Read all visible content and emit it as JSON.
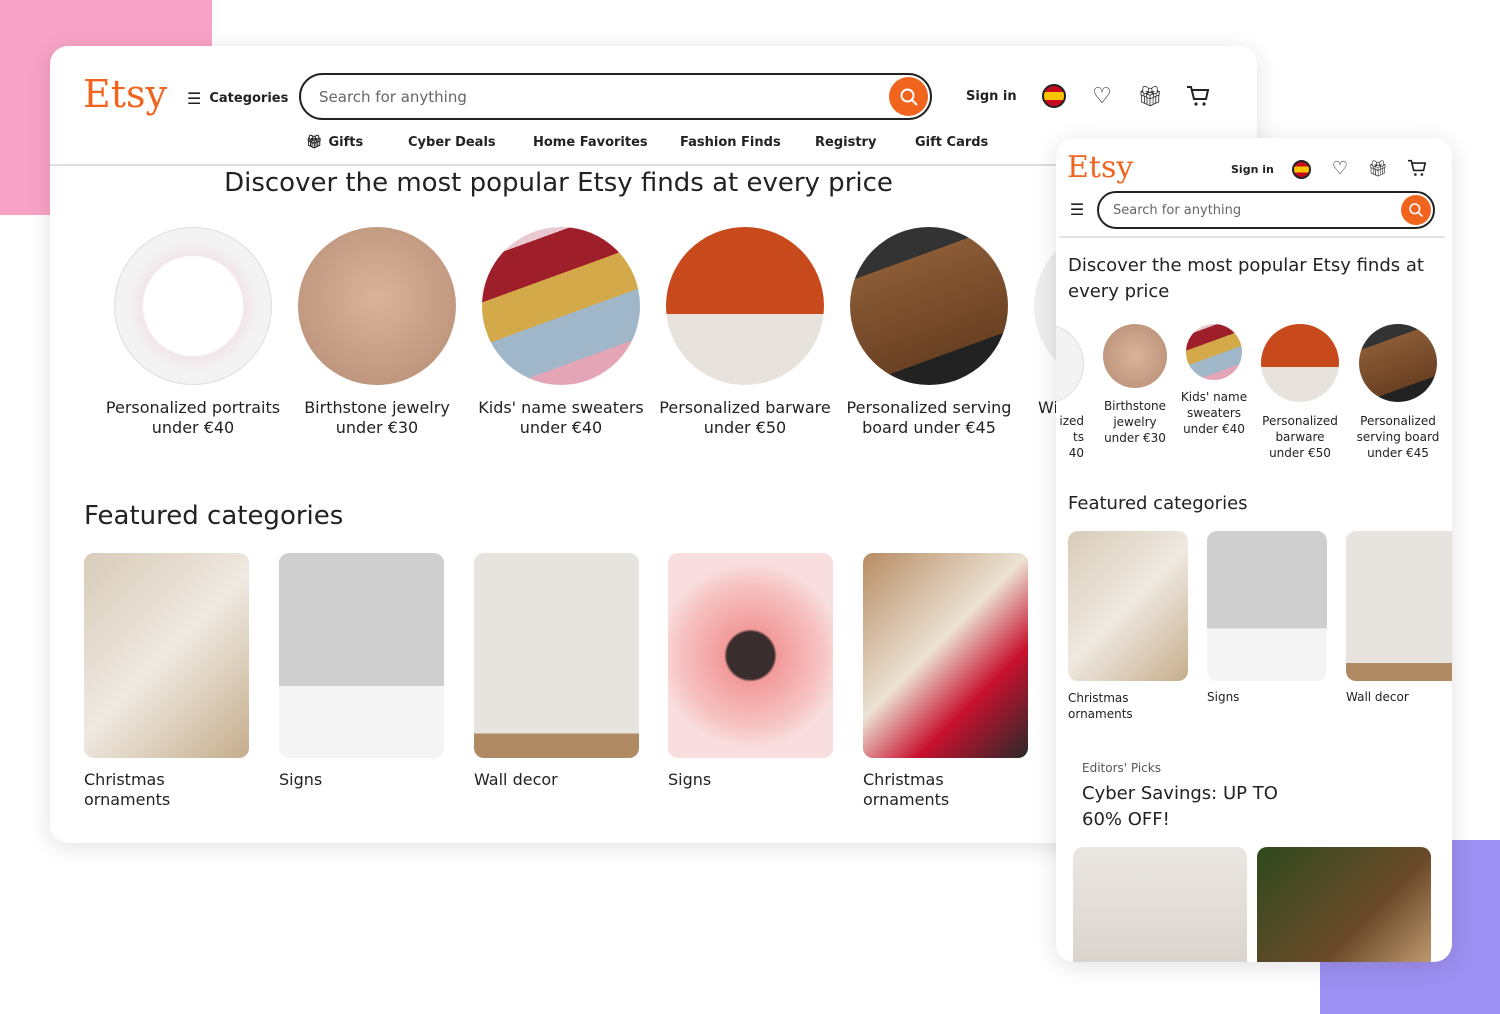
{
  "desktop": {
    "logo": "Etsy",
    "categories": "Categories",
    "search_placeholder": "Search for anything",
    "sign_in": "Sign in",
    "nav": [
      "Gifts",
      "Cyber Deals",
      "Home Favorites",
      "Fashion Finds",
      "Registry",
      "Gift Cards"
    ],
    "heading": "Discover the most popular Etsy finds at every price",
    "finds": [
      "Personalized portraits under €40",
      "Birthstone jewelry under €30",
      "Kids' name sweaters under €40",
      "Personalized barware under €50",
      "Personalized serving board under €45",
      "Wi"
    ],
    "featured_heading": "Featured categories",
    "featured": [
      "Christmas ornaments",
      "Signs",
      "Wall decor",
      "Signs",
      "Christmas ornaments"
    ]
  },
  "mobile": {
    "logo": "Etsy",
    "sign_in": "Sign in",
    "search_placeholder": "Search for anything",
    "heading": "Discover the most popular Etsy finds at every price",
    "finds": [
      "ized ts 40",
      "Birthstone jewelry under €30",
      "Kids' name sweaters under €40",
      "Personalized barware under €50",
      "Personalized serving board under €45"
    ],
    "featured_heading": "Featured categories",
    "featured": [
      "Christmas ornaments",
      "Signs",
      "Wall decor"
    ],
    "editors_label": "Editors' Picks",
    "editors_title": "Cyber Savings: UP TO 60% OFF!"
  },
  "colors": {
    "brand": "#f1641e",
    "pink": "#f8a3c6",
    "purple": "#9d90f2"
  }
}
